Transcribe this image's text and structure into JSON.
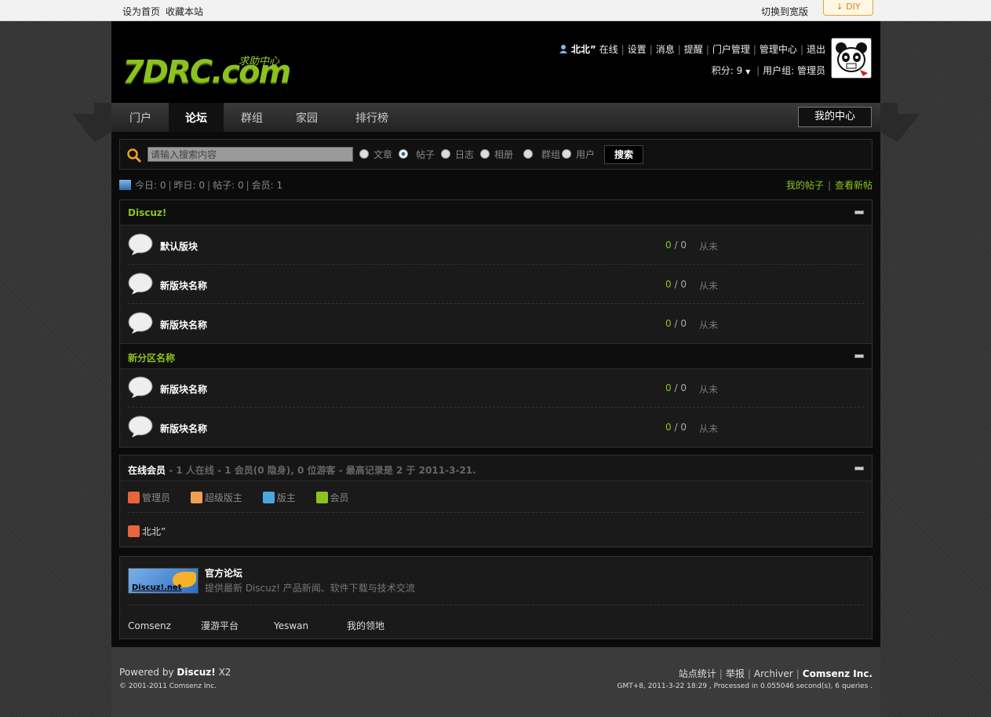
{
  "topbar": {
    "set_home": "设为首页",
    "bookmark": "收藏本站",
    "switch_width": "切换到宽版",
    "diy": "DIY"
  },
  "logo": {
    "main": "7DRC.com",
    "sub": "求助中心"
  },
  "user": {
    "name": "北北”",
    "status": "在线",
    "menu": [
      "设置",
      "消息",
      "提醒",
      "门户管理",
      "管理中心",
      "退出"
    ],
    "credits_label": "积分: 9",
    "group_label": "用户组: 管理员"
  },
  "nav": {
    "items": [
      "门户",
      "论坛",
      "群组",
      "家园",
      "排行榜"
    ],
    "active": "论坛",
    "my_center": "我的中心"
  },
  "search": {
    "placeholder": "请输入搜索内容",
    "options": [
      "文章",
      "帖子",
      "日志",
      "相册",
      "群组",
      "用户"
    ],
    "selected": "帖子",
    "button": "搜索"
  },
  "stats": {
    "today": "今日: 0",
    "yesterday": "昨日: 0",
    "posts": "帖子: 0",
    "members": "会员: 1",
    "my_posts": "我的帖子",
    "new_posts": "查看新帖"
  },
  "categories": [
    {
      "title": "Discuz!",
      "forums": [
        {
          "name": "默认版块",
          "threads": "0",
          "posts": "0",
          "last": "从未"
        },
        {
          "name": "新版块名称",
          "threads": "0",
          "posts": "0",
          "last": "从未"
        },
        {
          "name": "新版块名称",
          "threads": "0",
          "posts": "0",
          "last": "从未"
        }
      ]
    },
    {
      "title": "新分区名称",
      "forums": [
        {
          "name": "新版块名称",
          "threads": "0",
          "posts": "0",
          "last": "从未"
        },
        {
          "name": "新版块名称",
          "threads": "0",
          "posts": "0",
          "last": "从未"
        }
      ]
    }
  ],
  "online": {
    "title": "在线会员",
    "summary": "- 1 人在线 - 1 会员(0 隐身), 0 位游客 - 最高记录是 2 于 2011-3-21.",
    "legend": [
      {
        "label": "管理员",
        "color": "#e8643a"
      },
      {
        "label": "超级版主",
        "color": "#f0a050"
      },
      {
        "label": "版主",
        "color": "#4aa8e0"
      },
      {
        "label": "会员",
        "color": "#8cc21f"
      }
    ],
    "users": [
      "北北”"
    ]
  },
  "links": {
    "logo_text": "Discuz!.net",
    "title": "官方论坛",
    "desc": "提供最新 Discuz! 产品新闻、软件下载与技术交流",
    "text_links": [
      "Comsenz",
      "漫游平台",
      "Yeswan",
      "我的领地"
    ]
  },
  "footer": {
    "powered_prefix": "Powered by",
    "powered_brand": "Discuz!",
    "powered_ver": "X2",
    "copyright": "© 2001-2011 Comsenz Inc.",
    "links": [
      "站点统计",
      "举报",
      "Archiver"
    ],
    "company": "Comsenz Inc.",
    "gmt": "GMT+8, 2011-3-22 18:29 , Processed in 0.055046 second(s), 6 queries ."
  },
  "colors": {
    "accent": "#8cc21f",
    "background": "#0b0b0b"
  }
}
